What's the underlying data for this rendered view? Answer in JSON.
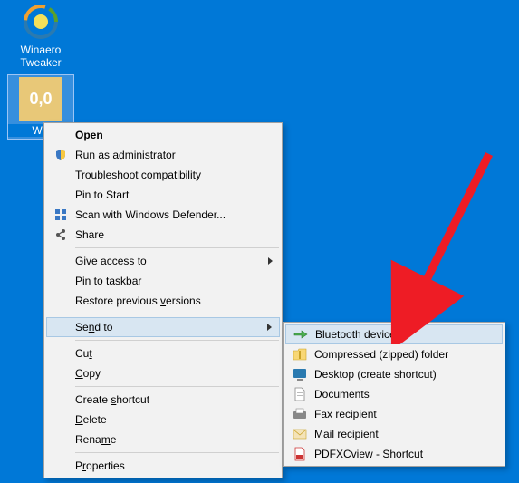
{
  "desktop": {
    "icons": [
      {
        "name": "winaero-tweaker",
        "label": "Winaero\nTweaker"
      },
      {
        "name": "webp-file",
        "label": "WE",
        "badge": "0,0"
      }
    ]
  },
  "menu": {
    "open": "Open",
    "run_admin": "Run as administrator",
    "troubleshoot": "Troubleshoot compatibility",
    "pin_start": "Pin to Start",
    "scan_defender": "Scan with Windows Defender...",
    "share": "Share",
    "give_access": {
      "pre": "Give ",
      "u": "a",
      "post": "ccess to"
    },
    "pin_taskbar": "Pin to taskbar",
    "restore_versions": {
      "pre": "Restore previous ",
      "u": "v",
      "post": "ersions"
    },
    "send_to": {
      "pre": "Se",
      "u": "n",
      "post": "d to"
    },
    "cut": {
      "pre": "Cu",
      "u": "t",
      "post": ""
    },
    "copy": {
      "pre": "",
      "u": "C",
      "post": "opy"
    },
    "create_shortcut": {
      "pre": "Create ",
      "u": "s",
      "post": "hortcut"
    },
    "delete": {
      "pre": "",
      "u": "D",
      "post": "elete"
    },
    "rename": {
      "pre": "Rena",
      "u": "m",
      "post": "e"
    },
    "properties": {
      "pre": "P",
      "u": "r",
      "post": "operties"
    }
  },
  "submenu": {
    "bluetooth": "Bluetooth device",
    "compressed": "Compressed (zipped) folder",
    "desktop_shortcut": "Desktop (create shortcut)",
    "documents": "Documents",
    "fax": "Fax recipient",
    "mail": "Mail recipient",
    "pdfx": "PDFXCview - Shortcut"
  },
  "colors": {
    "desktop_bg": "#0078d7",
    "menu_bg": "#f2f2f2",
    "hover_bg": "#d8e6f2",
    "arrow": "#ee1c25"
  }
}
